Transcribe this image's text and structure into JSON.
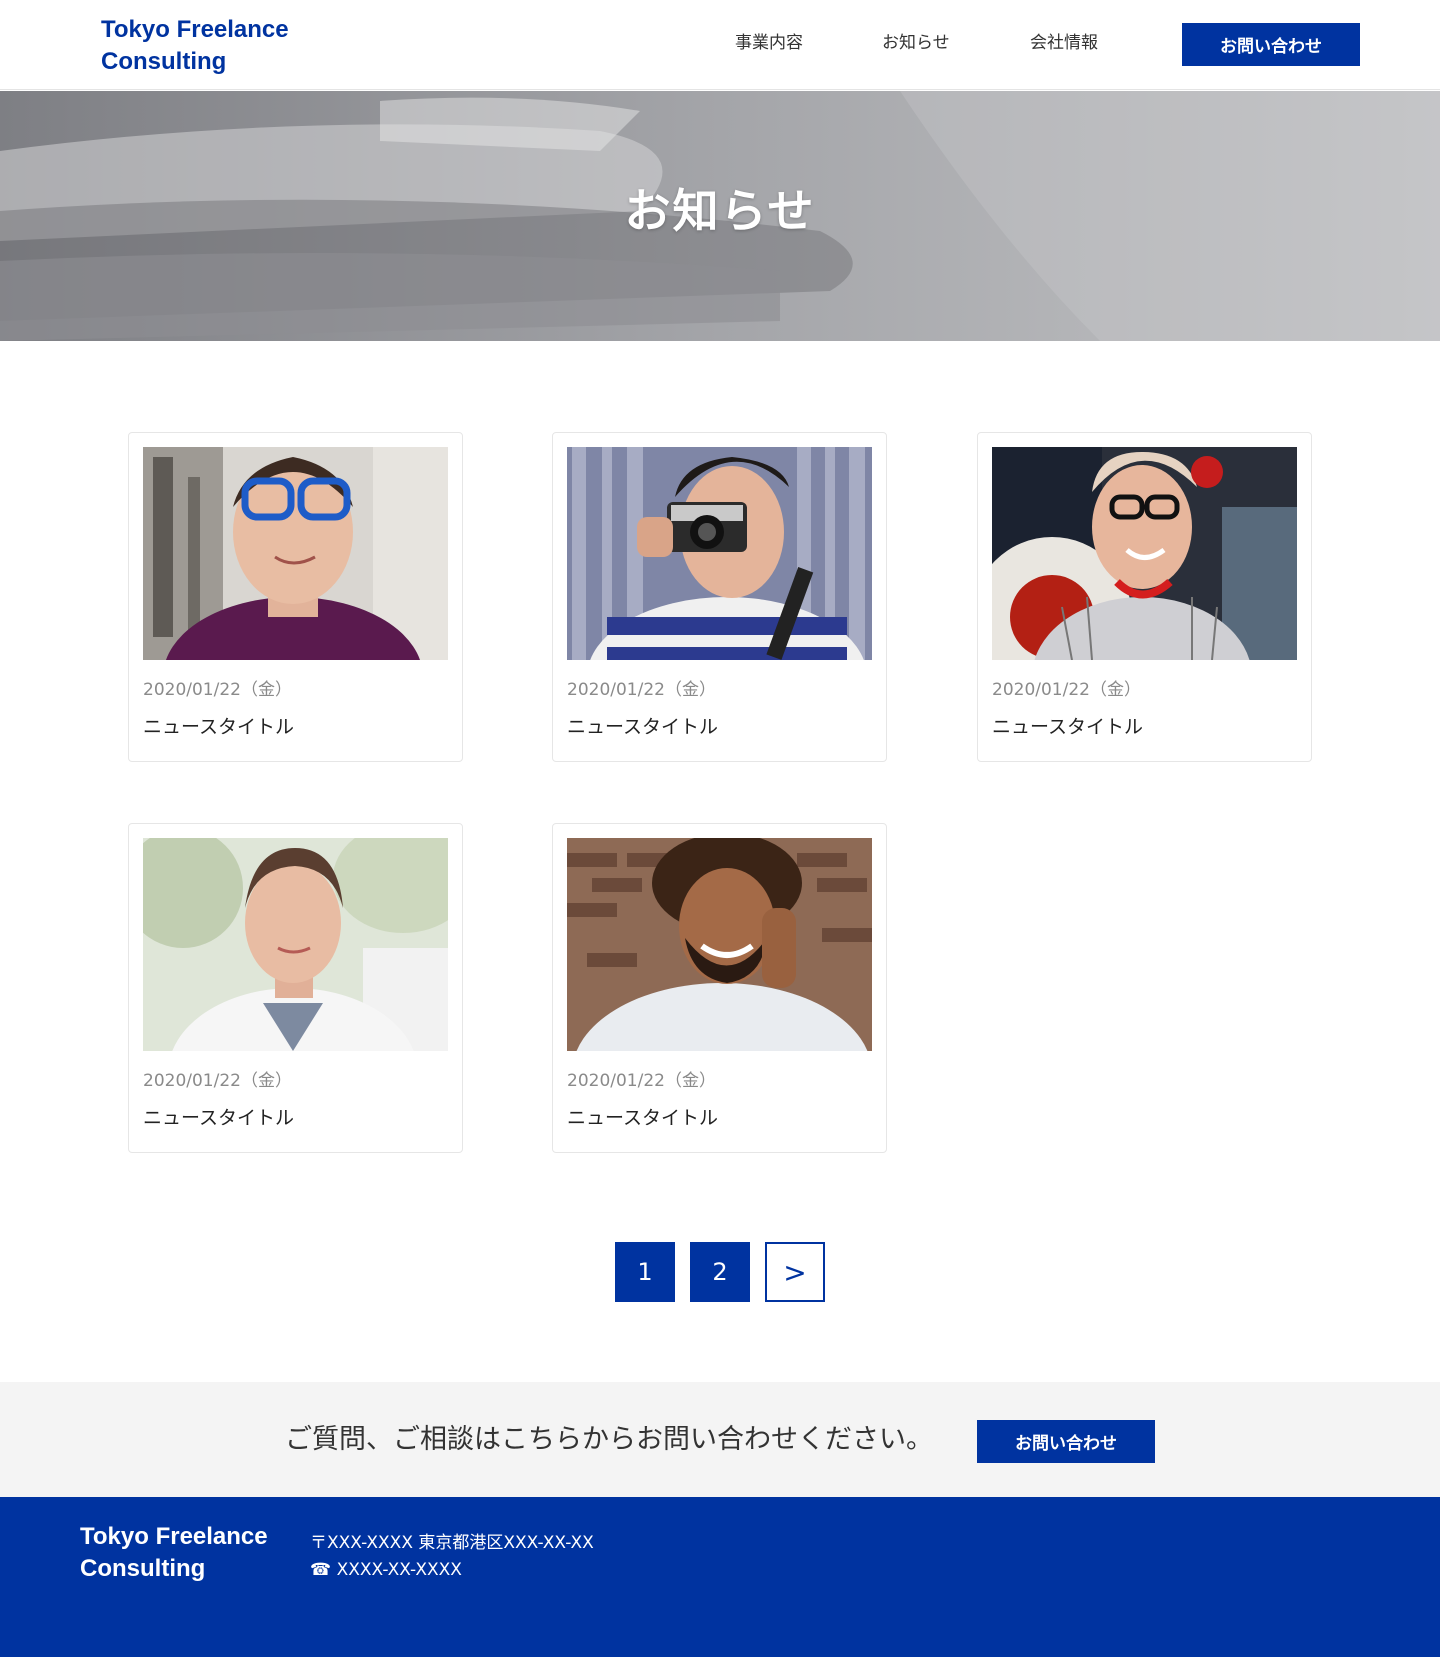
{
  "header": {
    "logo": "Tokyo Freelance\nConsulting",
    "nav": [
      "事業内容",
      "お知らせ",
      "会社情報"
    ],
    "cta": "お問い合わせ"
  },
  "hero": {
    "title": "お知らせ"
  },
  "news": [
    {
      "date": "2020/01/22（金）",
      "title": "ニュースタイトル",
      "image": "man-blue-glasses-photo"
    },
    {
      "date": "2020/01/22（金）",
      "title": "ニュースタイトル",
      "image": "man-with-camera-photo"
    },
    {
      "date": "2020/01/22（金）",
      "title": "ニュースタイトル",
      "image": "elderly-woman-glasses-photo"
    },
    {
      "date": "2020/01/22（金）",
      "title": "ニュースタイトル",
      "image": "woman-short-hair-photo"
    },
    {
      "date": "2020/01/22（金）",
      "title": "ニュースタイトル",
      "image": "smiling-man-curly-hair-photo"
    }
  ],
  "pagination": {
    "pages": [
      "1",
      "2"
    ],
    "next": ">"
  },
  "cta_band": {
    "text": "ご質問、ご相談はこちらからお問い合わせください。",
    "button": "お問い合わせ"
  },
  "footer": {
    "logo": "Tokyo Freelance\nConsulting",
    "address": "〒XXX-XXXX 東京都港区XXX-XX-XX",
    "tel": "☎ XXXX-XX-XXXX"
  },
  "colors": {
    "brand": "#0033a0",
    "footer_bg": "#0033a0",
    "cta_band_bg": "#f4f4f4"
  }
}
